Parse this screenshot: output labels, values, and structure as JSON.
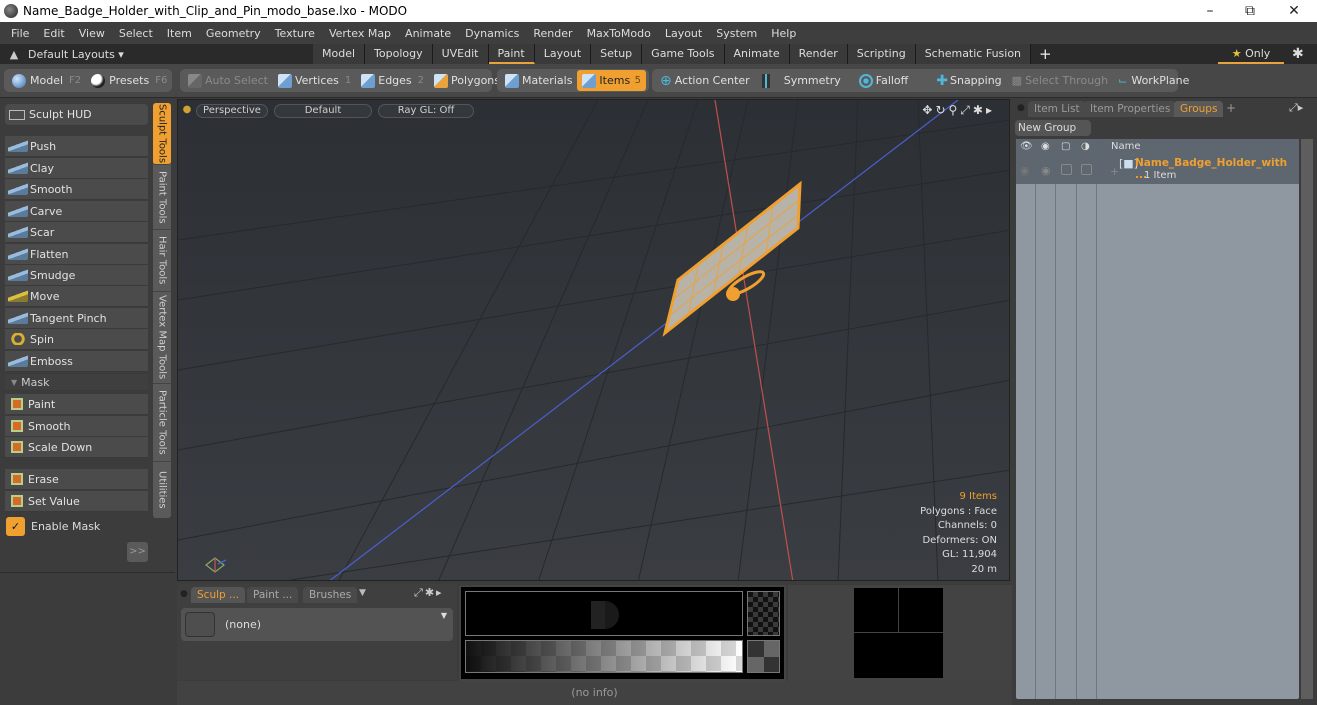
{
  "window": {
    "title": "Name_Badge_Holder_with_Clip_and_Pin_modo_base.lxo - MODO",
    "controls": [
      "minimize",
      "restore",
      "close"
    ]
  },
  "menu": [
    "File",
    "Edit",
    "View",
    "Select",
    "Item",
    "Geometry",
    "Texture",
    "Vertex Map",
    "Animate",
    "Dynamics",
    "Render",
    "MaxToModo",
    "Layout",
    "System",
    "Help"
  ],
  "layouts": {
    "dropdown": "Default Layouts ▾",
    "tabs": [
      "Model",
      "Topology",
      "UVEdit",
      "Paint",
      "Layout",
      "Setup",
      "Game Tools",
      "Animate",
      "Render",
      "Scripting",
      "Schematic Fusion"
    ],
    "active_tab": "Paint",
    "add": "+",
    "only_label": "Only"
  },
  "toolbar": {
    "model": "Model",
    "model_key": "F2",
    "presets": "Presets",
    "presets_key": "F6",
    "auto_select": "Auto Select",
    "vertices": "Vertices",
    "vertices_key": "1",
    "edges": "Edges",
    "edges_key": "2",
    "polygons": "Polygons",
    "materials": "Materials",
    "items": "Items",
    "items_key": "5",
    "action_center": "Action Center",
    "symmetry": "Symmetry",
    "falloff": "Falloff",
    "snapping": "Snapping",
    "select_through": "Select Through",
    "workplane": "WorkPlane"
  },
  "left_panel": {
    "sculpt_hud": "Sculpt HUD",
    "sculpt_tools": [
      "Push",
      "Clay",
      "Smooth",
      "Carve",
      "Scar",
      "Flatten",
      "Smudge",
      "Move",
      "Tangent Pinch",
      "Spin",
      "Emboss"
    ],
    "mask_header": "Mask",
    "mask_tools": [
      "Paint",
      "Smooth",
      "Scale Down"
    ],
    "mask_tools2": [
      "Erase",
      "Set Value"
    ],
    "enable_mask": "Enable Mask",
    "enable_mask_checked": true,
    "expand": ">>",
    "vertical_tabs": [
      "Sculpt Tools",
      "Paint Tools",
      "Hair Tools",
      "Vertex Map Tools",
      "Particle Tools",
      "Utilities"
    ],
    "active_vertical_tab": "Sculpt Tools"
  },
  "viewport": {
    "view": "Perspective",
    "shading": "Default",
    "raygl": "Ray GL: Off",
    "stats": {
      "items": "9 Items",
      "polygons": "Polygons : Face",
      "channels": "Channels: 0",
      "deformers": "Deformers: ON",
      "gl": "GL: 11,904",
      "distance": "20 m"
    }
  },
  "bottom_panel": {
    "tabs": [
      "Sculp ...",
      "Paint ...",
      "Brushes"
    ],
    "active_tab": "Sculp ...",
    "brush_value": "(none)"
  },
  "status": "(no info)",
  "right_panel": {
    "tabs": [
      "Item List",
      "Item Properties",
      "Groups"
    ],
    "active_tab": "Groups",
    "add": "+",
    "new_group": "New Group",
    "column_name": "Name",
    "rows": [
      {
        "name": "Name_Badge_Holder_with ...",
        "sub": "1 Item"
      }
    ]
  },
  "colors": {
    "accent": "#f0a030",
    "axis_x": "#c0504d",
    "axis_z": "#4a5fd0"
  }
}
